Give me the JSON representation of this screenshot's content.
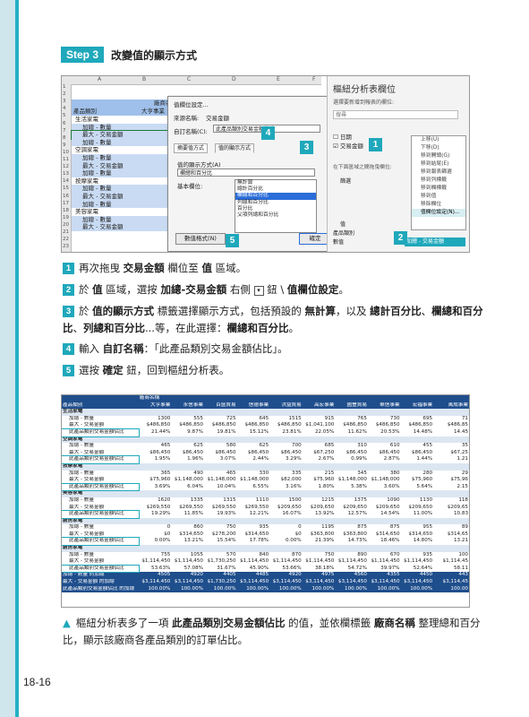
{
  "step": {
    "badge": "Step 3",
    "title": "改變值的顯示方式"
  },
  "sheet": {
    "columns": [
      "A",
      "B",
      "C",
      "D",
      "E",
      "F"
    ],
    "row_numbers": [
      "1",
      "2",
      "3",
      "4",
      "5",
      "6",
      "7",
      "8",
      "9",
      "10",
      "11",
      "12",
      "13",
      "14",
      "15",
      "16",
      "17",
      "18",
      "19",
      "20",
      "21",
      "22",
      "23"
    ],
    "header_cell": "廠商名",
    "product_header": "產品類別",
    "first_vendor": "大亨事業",
    "rows": [
      "生活家電",
      "加總 - 數量",
      "最大 - 交易金額",
      "加總 - 數量",
      "空調家電",
      "加總 - 數量",
      "最大 - 交易金額",
      "加總 - 數量",
      "按摩家電",
      "加總 - 數量",
      "最大 - 交易金額",
      "加總 - 數量",
      "美容家電",
      "加總 - 數量",
      "最大 - 交易金額"
    ]
  },
  "dialog": {
    "title": "值欄位設定...",
    "source_label": "來源名稱:",
    "source_value": "交易金額",
    "custom_label": "自訂名稱(C):",
    "custom_value": "此產品類別交易金額佔比",
    "tab1": "摘要值方式",
    "tab2": "值的顯示方式",
    "show_label": "值的顯示方式(A)",
    "show_value": "欄總和百分比",
    "base_label": "基本欄位:",
    "list": [
      "無計算",
      "總計百分比",
      "欄總和百分比",
      "列總和百分比",
      "百分比",
      "父項列總和百分比"
    ],
    "format_button": "數值格式(N)",
    "ok_button": "確定",
    "cancel_button": "取消"
  },
  "pivot": {
    "title": "樞紐分析表欄位",
    "sub": "選擇要新增到報表的欄位:",
    "search_placeholder": "搜尋",
    "fields": [
      "日期",
      "交易金額"
    ],
    "area_label": "在下面區域之間拖曳欄位:",
    "filter_label": "篩選",
    "values_label": "值",
    "value_items": [
      "產品類別",
      "數值"
    ],
    "value_chip": "加總 - 交易金額",
    "menu": [
      "上移(U)",
      "下移(D)",
      "移到開頭(G)",
      "移到結尾(E)",
      "移到報表篩選",
      "移到列標籤",
      "移到欄標籤",
      "移到值",
      "移除欄位",
      "值欄位設定(N)..."
    ]
  },
  "callouts": [
    "1",
    "2",
    "3",
    "4",
    "5"
  ],
  "instructions": [
    {
      "n": "1",
      "parts": [
        [
          "再次拖曳 ",
          ""
        ],
        [
          "交易金額",
          "b"
        ],
        [
          " 欄位至 ",
          ""
        ],
        [
          "值",
          "b"
        ],
        [
          " 區域。",
          ""
        ]
      ]
    },
    {
      "n": "2",
      "parts": [
        [
          "於 ",
          ""
        ],
        [
          "值",
          "b"
        ],
        [
          " 區域，選按 ",
          ""
        ],
        [
          "加總-交易金額",
          "b"
        ],
        [
          " 右側 ",
          ""
        ],
        [
          "▾",
          "k"
        ],
        [
          " 鈕 \\ ",
          ""
        ],
        [
          "值欄位設定",
          "b"
        ],
        [
          "。",
          ""
        ]
      ]
    },
    {
      "n": "3",
      "parts": [
        [
          "於 ",
          ""
        ],
        [
          "值的顯示方式",
          "b"
        ],
        [
          " 標籤選擇顯示方式，包括預設的 ",
          ""
        ],
        [
          "無計算",
          "b"
        ],
        [
          "，以及 ",
          ""
        ],
        [
          "總計百分比",
          "b"
        ],
        [
          "、",
          ""
        ],
        [
          "欄總和百分比",
          "b"
        ],
        [
          "、",
          ""
        ],
        [
          "列總和百分比",
          "b"
        ],
        [
          "...等，在此選擇：",
          ""
        ],
        [
          "欄總和百分比",
          "b"
        ],
        [
          "。",
          ""
        ]
      ]
    },
    {
      "n": "4",
      "parts": [
        [
          "輸入 ",
          ""
        ],
        [
          "自訂名稱",
          "b"
        ],
        [
          "：「此產品類別交易金額佔比」。",
          ""
        ]
      ]
    },
    {
      "n": "5",
      "parts": [
        [
          "選按 ",
          ""
        ],
        [
          "確定",
          "b"
        ],
        [
          " 鈕，回到樞紐分析表。",
          ""
        ]
      ]
    }
  ],
  "table": {
    "header1": [
      "",
      "廠商名稱",
      "",
      "",
      "",
      "",
      "",
      "",
      "",
      "",
      "",
      ""
    ],
    "header2": [
      "產品類別",
      "大亨事業",
      "永信事業",
      "百盛貿易",
      "信德事業",
      "洪益貿易",
      "高宏事業",
      "國豐貿易",
      "華信事業",
      "宏福事業",
      "萬成事業",
      "信發事業"
    ],
    "rows": [
      {
        "t": "grp",
        "c": [
          "生活家電",
          "",
          "",
          "",
          "",
          "",
          "",
          "",
          "",
          "",
          "",
          ""
        ]
      },
      {
        "t": "",
        "c": [
          "加總 - 數量",
          "1300",
          "555",
          "725",
          "645",
          "1515",
          "915",
          "765",
          "730",
          "695",
          "71"
        ]
      },
      {
        "t": "",
        "c": [
          "最大 - 交易金額",
          "$486,850",
          "$486,850",
          "$486,850",
          "$486,850",
          "$486,850",
          "$1,041,100",
          "$486,850",
          "$486,850",
          "$486,850",
          "$486,85"
        ]
      },
      {
        "t": "pct",
        "c": [
          "此產品類別交易金額佔比",
          "21.44%",
          "9.87%",
          "19.81%",
          "15.12%",
          "23.81%",
          "22.05%",
          "11.62%",
          "20.53%",
          "14.48%",
          "14.45"
        ]
      },
      {
        "t": "grp",
        "c": [
          "空調家電",
          "",
          "",
          "",
          "",
          "",
          "",
          "",
          "",
          "",
          ""
        ]
      },
      {
        "t": "",
        "c": [
          "加總 - 數量",
          "465",
          "625",
          "580",
          "625",
          "700",
          "685",
          "310",
          "610",
          "455",
          "35"
        ]
      },
      {
        "t": "",
        "c": [
          "最大 - 交易金額",
          "$86,450",
          "$86,450",
          "$86,450",
          "$86,450",
          "$86,450",
          "$67,250",
          "$86,450",
          "$86,450",
          "$86,450",
          "$67,25"
        ]
      },
      {
        "t": "pct",
        "c": [
          "此產品類別交易金額佔比",
          "1.95%",
          "1.96%",
          "3.07%",
          "2.44%",
          "3.29%",
          "2.67%",
          "0.99%",
          "2.87%",
          "1.44%",
          "1.21"
        ]
      },
      {
        "t": "grp",
        "c": [
          "按摩家電",
          "",
          "",
          "",
          "",
          "",
          "",
          "",
          "",
          "",
          ""
        ]
      },
      {
        "t": "",
        "c": [
          "加總 - 數量",
          "365",
          "490",
          "465",
          "330",
          "335",
          "215",
          "345",
          "380",
          "280",
          "29"
        ]
      },
      {
        "t": "",
        "c": [
          "最大 - 交易金額",
          "$75,960",
          "$1,148,000",
          "$1,148,000",
          "$1,148,000",
          "$82,000",
          "$75,960",
          "$1,148,000",
          "$1,148,000",
          "$75,960",
          "$75,96"
        ]
      },
      {
        "t": "pct",
        "c": [
          "此產品類別交易金額佔比",
          "3.69%",
          "6.04%",
          "10.04%",
          "6.55%",
          "3.16%",
          "1.80%",
          "5.38%",
          "3.60%",
          "5.64%",
          "2.15"
        ]
      },
      {
        "t": "grp",
        "c": [
          "美容家電",
          "",
          "",
          "",
          "",
          "",
          "",
          "",
          "",
          "",
          ""
        ]
      },
      {
        "t": "",
        "c": [
          "加總 - 數量",
          "1620",
          "1335",
          "1315",
          "1110",
          "1500",
          "1215",
          "1375",
          "1090",
          "1130",
          "118"
        ]
      },
      {
        "t": "",
        "c": [
          "最大 - 交易金額",
          "$269,550",
          "$269,550",
          "$269,550",
          "$269,550",
          "$209,650",
          "$209,650",
          "$209,650",
          "$209,650",
          "$209,650",
          "$209,65"
        ]
      },
      {
        "t": "pct",
        "c": [
          "此產品類別交易金額佔比",
          "19.29%",
          "11.85%",
          "19.93%",
          "12.21%",
          "16.07%",
          "13.92%",
          "12.57%",
          "14.54%",
          "11.00%",
          "10.83"
        ]
      },
      {
        "t": "grp",
        "c": [
          "廚房家電",
          "",
          "",
          "",
          "",
          "",
          "",
          "",
          "",
          "",
          ""
        ]
      },
      {
        "t": "",
        "c": [
          "加總 - 數量",
          "0",
          "860",
          "750",
          "935",
          "0",
          "1195",
          "875",
          "875",
          "955",
          "89"
        ]
      },
      {
        "t": "",
        "c": [
          "最大 - 交易金額",
          "$0",
          "$314,650",
          "$278,200",
          "$314,650",
          "$0",
          "$363,800",
          "$363,800",
          "$314,650",
          "$314,650",
          "$314,65"
        ]
      },
      {
        "t": "pct",
        "c": [
          "此產品類別交易金額佔比",
          "0.00%",
          "13.21%",
          "15.54%",
          "17.78%",
          "0.00%",
          "21.39%",
          "14.73%",
          "18.46%",
          "14.80%",
          "13.21"
        ]
      },
      {
        "t": "grp",
        "c": [
          "廚房家電",
          "",
          "",
          "",
          "",
          "",
          "",
          "",
          "",
          "",
          ""
        ]
      },
      {
        "t": "",
        "c": [
          "加總 - 數量",
          "755",
          "1055",
          "570",
          "840",
          "870",
          "750",
          "890",
          "670",
          "935",
          "100"
        ]
      },
      {
        "t": "",
        "c": [
          "最大 - 交易金額",
          "$1,114,450",
          "$1,114,450",
          "$1,730,250",
          "$1,114,450",
          "$1,114,450",
          "$1,114,450",
          "$1,114,450",
          "$1,114,450",
          "$1,114,450",
          "$1,114,45"
        ]
      },
      {
        "t": "pct",
        "c": [
          "此產品類別交易金額佔比",
          "53.63%",
          "57.08%",
          "31.67%",
          "45.90%",
          "53.66%",
          "38.18%",
          "54.72%",
          "39.97%",
          "52.64%",
          "58.11"
        ]
      },
      {
        "t": "tot",
        "c": [
          "加總 - 數量 的加總",
          "4505",
          "4920",
          "4405",
          "4485",
          "4920",
          "4975",
          "4560",
          "4355",
          "4450",
          "443"
        ]
      },
      {
        "t": "tot",
        "c": [
          "最大 - 交易金額 的加總",
          "$3,114,450",
          "$3,114,450",
          "$1,730,250",
          "$3,114,450",
          "$3,114,450",
          "$3,114,450",
          "$3,114,450",
          "$3,114,450",
          "$3,114,450",
          "$3,114,45"
        ]
      },
      {
        "t": "tot",
        "c": [
          "此產品類別交易金額佔比 的加總",
          "100.00%",
          "100.00%",
          "100.00%",
          "100.00%",
          "100.00%",
          "100.00%",
          "100.00%",
          "100.00%",
          "100.00%",
          "100.00"
        ]
      }
    ]
  },
  "caption": [
    [
      "樞紐分析表多了一項 ",
      ""
    ],
    [
      "此產品類別交易金額佔比",
      "b"
    ],
    [
      " 的值，並依欄標籤 ",
      ""
    ],
    [
      "廠商名稱",
      "b"
    ],
    [
      " 整理總和百分比，顯示該廠商各產品類別的訂單佔比。",
      ""
    ]
  ],
  "page_number": "18-16"
}
